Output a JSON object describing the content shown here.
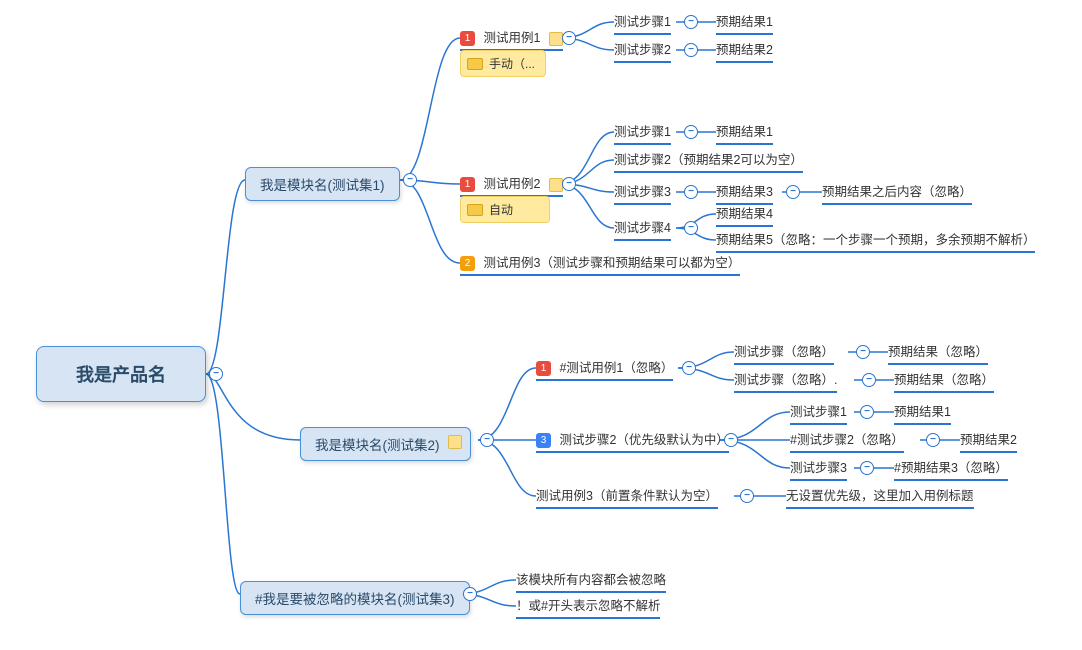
{
  "root": "我是产品名",
  "mod1": {
    "label": "我是模块名(测试集1)"
  },
  "mod2": {
    "label": "我是模块名(测试集2)"
  },
  "mod3": {
    "label": "#我是要被忽略的模块名(测试集3)"
  },
  "tc1": {
    "priority": "1",
    "label": "测试用例1",
    "tag": "手动（..."
  },
  "tc2": {
    "priority": "1",
    "label": "测试用例2",
    "tag": "自动"
  },
  "tc3": {
    "priority": "2",
    "label": "测试用例3（测试步骤和预期结果可以都为空）"
  },
  "tc4": {
    "priority": "1",
    "label": "#测试用例1（忽略）"
  },
  "tc5": {
    "priority": "3",
    "label": "测试步骤2（优先级默认为中）"
  },
  "tc6": {
    "label": "测试用例3（前置条件默认为空）"
  },
  "tc6r": "无设置优先级，这里加入用例标题",
  "s": {
    "a1": "测试步骤1",
    "a1r": "预期结果1",
    "a2": "测试步骤2",
    "a2r": "预期结果2",
    "b1": "测试步骤1",
    "b1r": "预期结果1",
    "b2": "测试步骤2（预期结果2可以为空）",
    "b3": "测试步骤3",
    "b3r": "预期结果3",
    "b3rr": "预期结果之后内容（忽略）",
    "b4": "测试步骤4",
    "b4r1": "预期结果4",
    "b4r2": "预期结果5（忽略：一个步骤一个预期，多余预期不解析）",
    "c1": "测试步骤（忽略）",
    "c1r": "预期结果（忽略）",
    "c2": "测试步骤（忽略）.",
    "c2r": "预期结果（忽略）",
    "d1": "测试步骤1",
    "d1r": "预期结果1",
    "d2": "#测试步骤2（忽略）",
    "d2r": "预期结果2",
    "d3": "测试步骤3",
    "d3r": "#预期结果3（忽略）"
  },
  "ign": {
    "l1": "该模块所有内容都会被忽略",
    "l2": "！或#开头表示忽略不解析"
  }
}
